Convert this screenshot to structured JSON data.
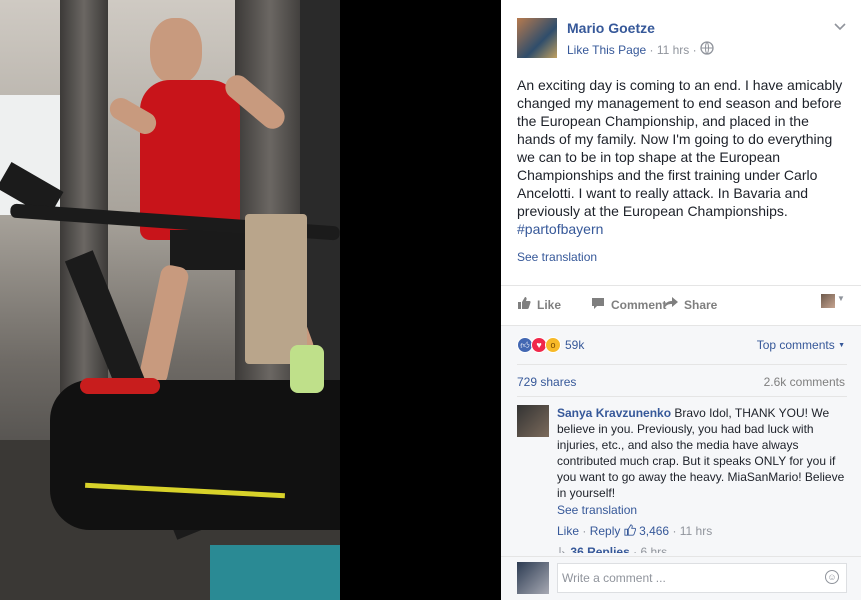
{
  "post": {
    "author": "Mario Goetze",
    "like_page": "Like This Page",
    "time": "· 11 hrs ·",
    "text": "An exciting day is coming to an end. I have amicably changed my management to end season and before the European Championship, and placed in the hands of my family. Now I'm going to do everything we can to be in top shape at the European Championships and the first training under Carlo Ancelotti. I want to really attack. In Bavaria and previously at the European Championships.",
    "hashtag": "#partofbayern",
    "see_translation": "See translation"
  },
  "actions": {
    "like": "Like",
    "comment": "Comment",
    "share": "Share"
  },
  "stats": {
    "reaction_count": "59k",
    "top_comments": "Top comments",
    "shares": "729 shares",
    "comments": "2.6k comments"
  },
  "comment": {
    "name": "Sanya Kravzunenko",
    "text": "Bravo Idol, THANK YOU! We believe in you. Previously, you had bad luck with injuries, etc., and also the media have always contributed much crap. But it speaks ONLY for you if you want to go away the heavy. MiaSanMario! Believe in yourself!",
    "see_translation": "See translation",
    "like": "Like",
    "reply": "Reply",
    "likes": "3,466",
    "time": "· 11 hrs",
    "replies": "36 Replies",
    "replies_time": "· 6 hrs"
  },
  "composer": {
    "placeholder": "Write a comment ..."
  },
  "colors": {
    "link": "#365899",
    "muted": "#90949c",
    "panel_bg": "#ffffff",
    "footer_bg": "#f6f7f9"
  },
  "icons": [
    "chevron-down-icon",
    "globe-icon",
    "thumbs-up-icon",
    "comment-icon",
    "share-icon",
    "smiley-icon"
  ]
}
